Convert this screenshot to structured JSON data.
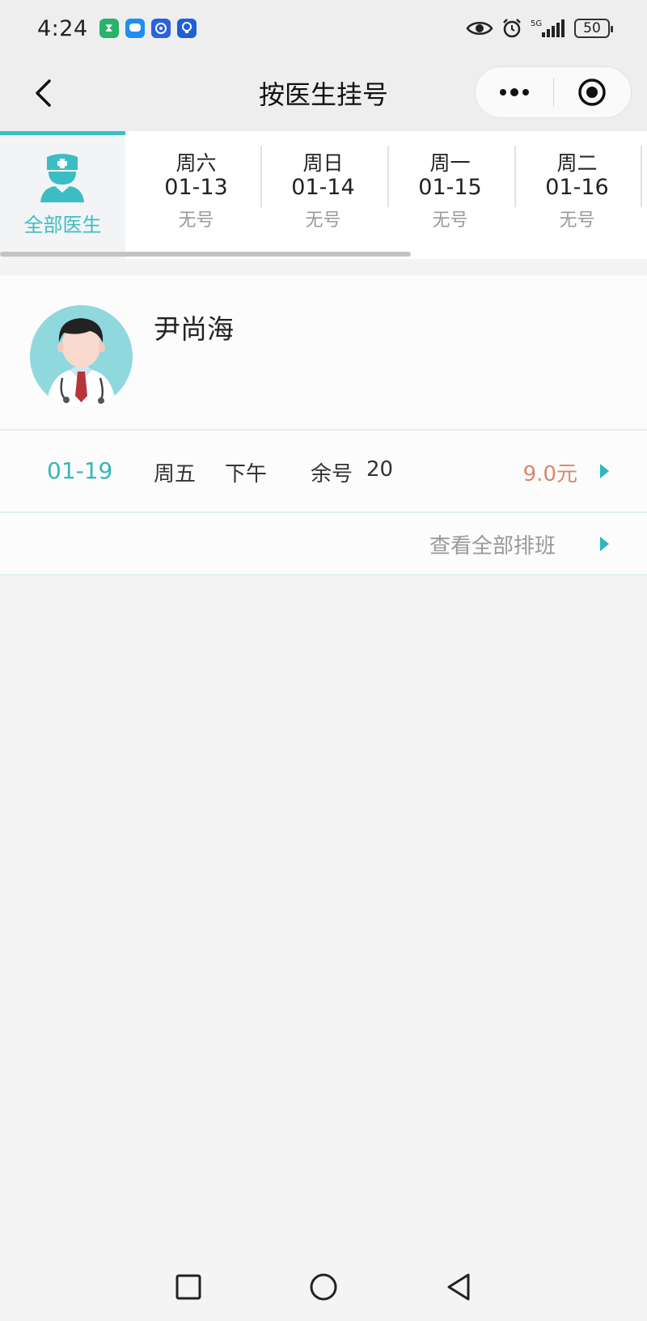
{
  "status_bar": {
    "time": "4:24",
    "network": "5G",
    "battery": "50",
    "app_icons": [
      "hourglass-icon",
      "message-icon",
      "blue-app-icon",
      "bulb-icon"
    ]
  },
  "nav": {
    "title": "按医生挂号",
    "more_icon": "more-dots-icon",
    "close_icon": "target-icon"
  },
  "date_strip": {
    "all_doctors_label": "全部医生",
    "days": [
      {
        "weekday": "周六",
        "date": "01-13",
        "availability": "无号"
      },
      {
        "weekday": "周日",
        "date": "01-14",
        "availability": "无号"
      },
      {
        "weekday": "周一",
        "date": "01-15",
        "availability": "无号"
      },
      {
        "weekday": "周二",
        "date": "01-16",
        "availability": "无号"
      }
    ]
  },
  "doctor": {
    "name": "尹尚海",
    "slot": {
      "date": "01-19",
      "weekday": "周五",
      "period": "下午",
      "remaining_label": "余号",
      "remaining_count": "20",
      "price": "9.0元"
    },
    "view_all_label": "查看全部排班"
  },
  "colors": {
    "accent": "#3bc0c6",
    "price": "#d8876a",
    "muted": "#9a9a9a"
  }
}
